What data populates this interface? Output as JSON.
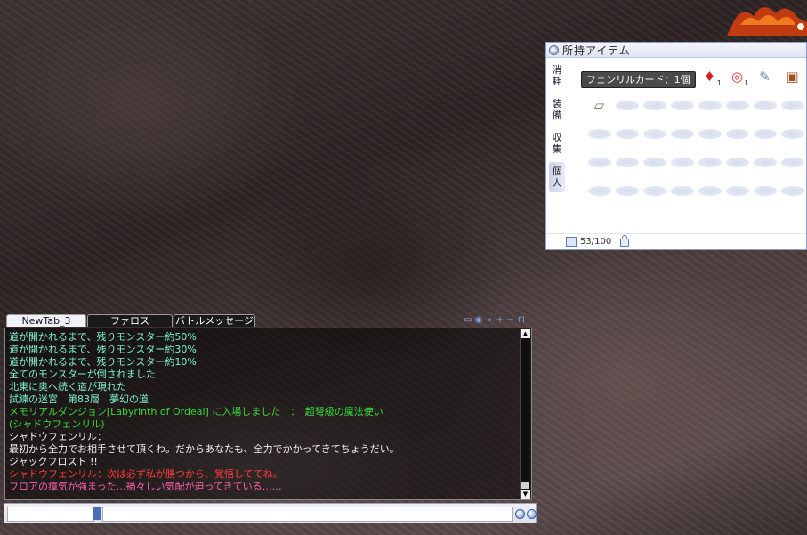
{
  "inventory": {
    "title": "所持アイテム",
    "tabs": [
      "消耗",
      "装備",
      "収集",
      "個人"
    ],
    "active_tab": "個人",
    "tooltip": "フェンリルカード：1個",
    "capacity": "53/100",
    "slots": [
      {
        "icon": "card-icon",
        "glyph": "▤",
        "color": "#b08060"
      },
      {
        "icon": "pouch-icon",
        "glyph": "◆",
        "color": "#a060a0"
      },
      {
        "icon": "orb-icon",
        "glyph": "●",
        "color": "#8f7fd8"
      },
      {
        "icon": "book-item-icon",
        "glyph": "▰",
        "color": "#707060"
      },
      {
        "icon": "potion-icon",
        "glyph": "♦",
        "color": "#d02020",
        "qty": "1"
      },
      {
        "icon": "ribbon-icon",
        "glyph": "◎",
        "color": "#d83030",
        "qty": "1"
      },
      {
        "icon": "scroll-item-icon",
        "glyph": "✎",
        "color": "#708090"
      },
      {
        "icon": "chest-icon",
        "glyph": "▣",
        "color": "#a05020"
      },
      {
        "icon": "note-icon",
        "glyph": "▱",
        "color": "#777755"
      }
    ]
  },
  "chat": {
    "tabs": [
      {
        "label": "NewTab_3",
        "active": true
      },
      {
        "label": "ファロス",
        "active": false
      },
      {
        "label": "バトルメッセージ",
        "active": false
      }
    ],
    "lines": [
      {
        "text": "道が開かれるまで、残りモンスター約50%",
        "color": "cyan"
      },
      {
        "text": "道が開かれるまで、残りモンスター約30%",
        "color": "cyan"
      },
      {
        "text": "道が開かれるまで、残りモンスター約10%",
        "color": "cyan"
      },
      {
        "text": "全てのモンスターが倒されました",
        "color": "cyan"
      },
      {
        "text": "北東に奥へ続く道が現れた",
        "color": "cyan"
      },
      {
        "text": "試練の迷宮　第83層　夢幻の道",
        "color": "cyan"
      },
      {
        "text": "メモリアルダンジョン[Labyrinth of Ordeal] に入場しました　：　超弩級の魔法使い",
        "color": "green"
      },
      {
        "text": "(シャドウフェンリル)",
        "color": "green"
      },
      {
        "text": "シャドウフェンリル：",
        "color": "white"
      },
      {
        "text": "最初から全力でお相手させて頂くわ。だからあなたも、全力でかかってきてちょうだい。",
        "color": "white"
      },
      {
        "text": "ジャックフロスト !!",
        "color": "white"
      },
      {
        "text": "シャドウフェンリル：次は必ず私が勝つから、覚悟しててね。",
        "color": "red"
      },
      {
        "text": "フロアの瘴気が強まった…禍々しい気配が迫ってきている……",
        "color": "pink"
      }
    ]
  }
}
